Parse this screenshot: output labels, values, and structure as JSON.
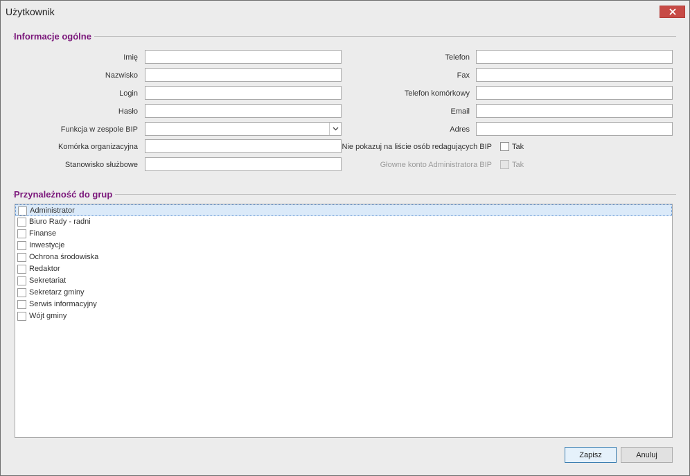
{
  "window": {
    "title": "Użytkownik"
  },
  "general": {
    "title": "Informacje ogólne",
    "left_fields": [
      {
        "label": "Imię",
        "value": ""
      },
      {
        "label": "Nazwisko",
        "value": ""
      },
      {
        "label": "Login",
        "value": ""
      },
      {
        "label": "Hasło",
        "value": ""
      },
      {
        "label": "Funkcja w zespole BIP",
        "value": ""
      },
      {
        "label": "Komórka organizacyjna",
        "value": ""
      },
      {
        "label": "Stanowisko służbowe",
        "value": ""
      }
    ],
    "right_fields": [
      {
        "label": "Telefon",
        "value": ""
      },
      {
        "label": "Fax",
        "value": ""
      },
      {
        "label": "Telefon komórkowy",
        "value": ""
      },
      {
        "label": "Email",
        "value": ""
      },
      {
        "label": "Adres",
        "value": ""
      }
    ],
    "hide_on_list": {
      "label": "Nie pokazuj na liście osób redagujących BIP",
      "check_label": "Tak",
      "checked": false
    },
    "main_admin": {
      "label": "Głowne konto Administratora BIP",
      "check_label": "Tak",
      "checked": false,
      "disabled": true
    }
  },
  "groups": {
    "title": "Przynależność do grup",
    "items": [
      {
        "label": "Administrator",
        "checked": false,
        "selected": true
      },
      {
        "label": "Biuro Rady - radni",
        "checked": false
      },
      {
        "label": "Finanse",
        "checked": false
      },
      {
        "label": "Inwestycje",
        "checked": false
      },
      {
        "label": "Ochrona środowiska",
        "checked": false
      },
      {
        "label": "Redaktor",
        "checked": false
      },
      {
        "label": "Sekretariat",
        "checked": false
      },
      {
        "label": "Sekretarz gminy",
        "checked": false
      },
      {
        "label": "Serwis informacyjny",
        "checked": false
      },
      {
        "label": "Wójt gminy",
        "checked": false
      }
    ]
  },
  "footer": {
    "save_label": "Zapisz",
    "cancel_label": "Anuluj"
  },
  "colors": {
    "section_title": "#7a167a",
    "close_button": "#c74b46",
    "selection": "#dbeaf9"
  }
}
